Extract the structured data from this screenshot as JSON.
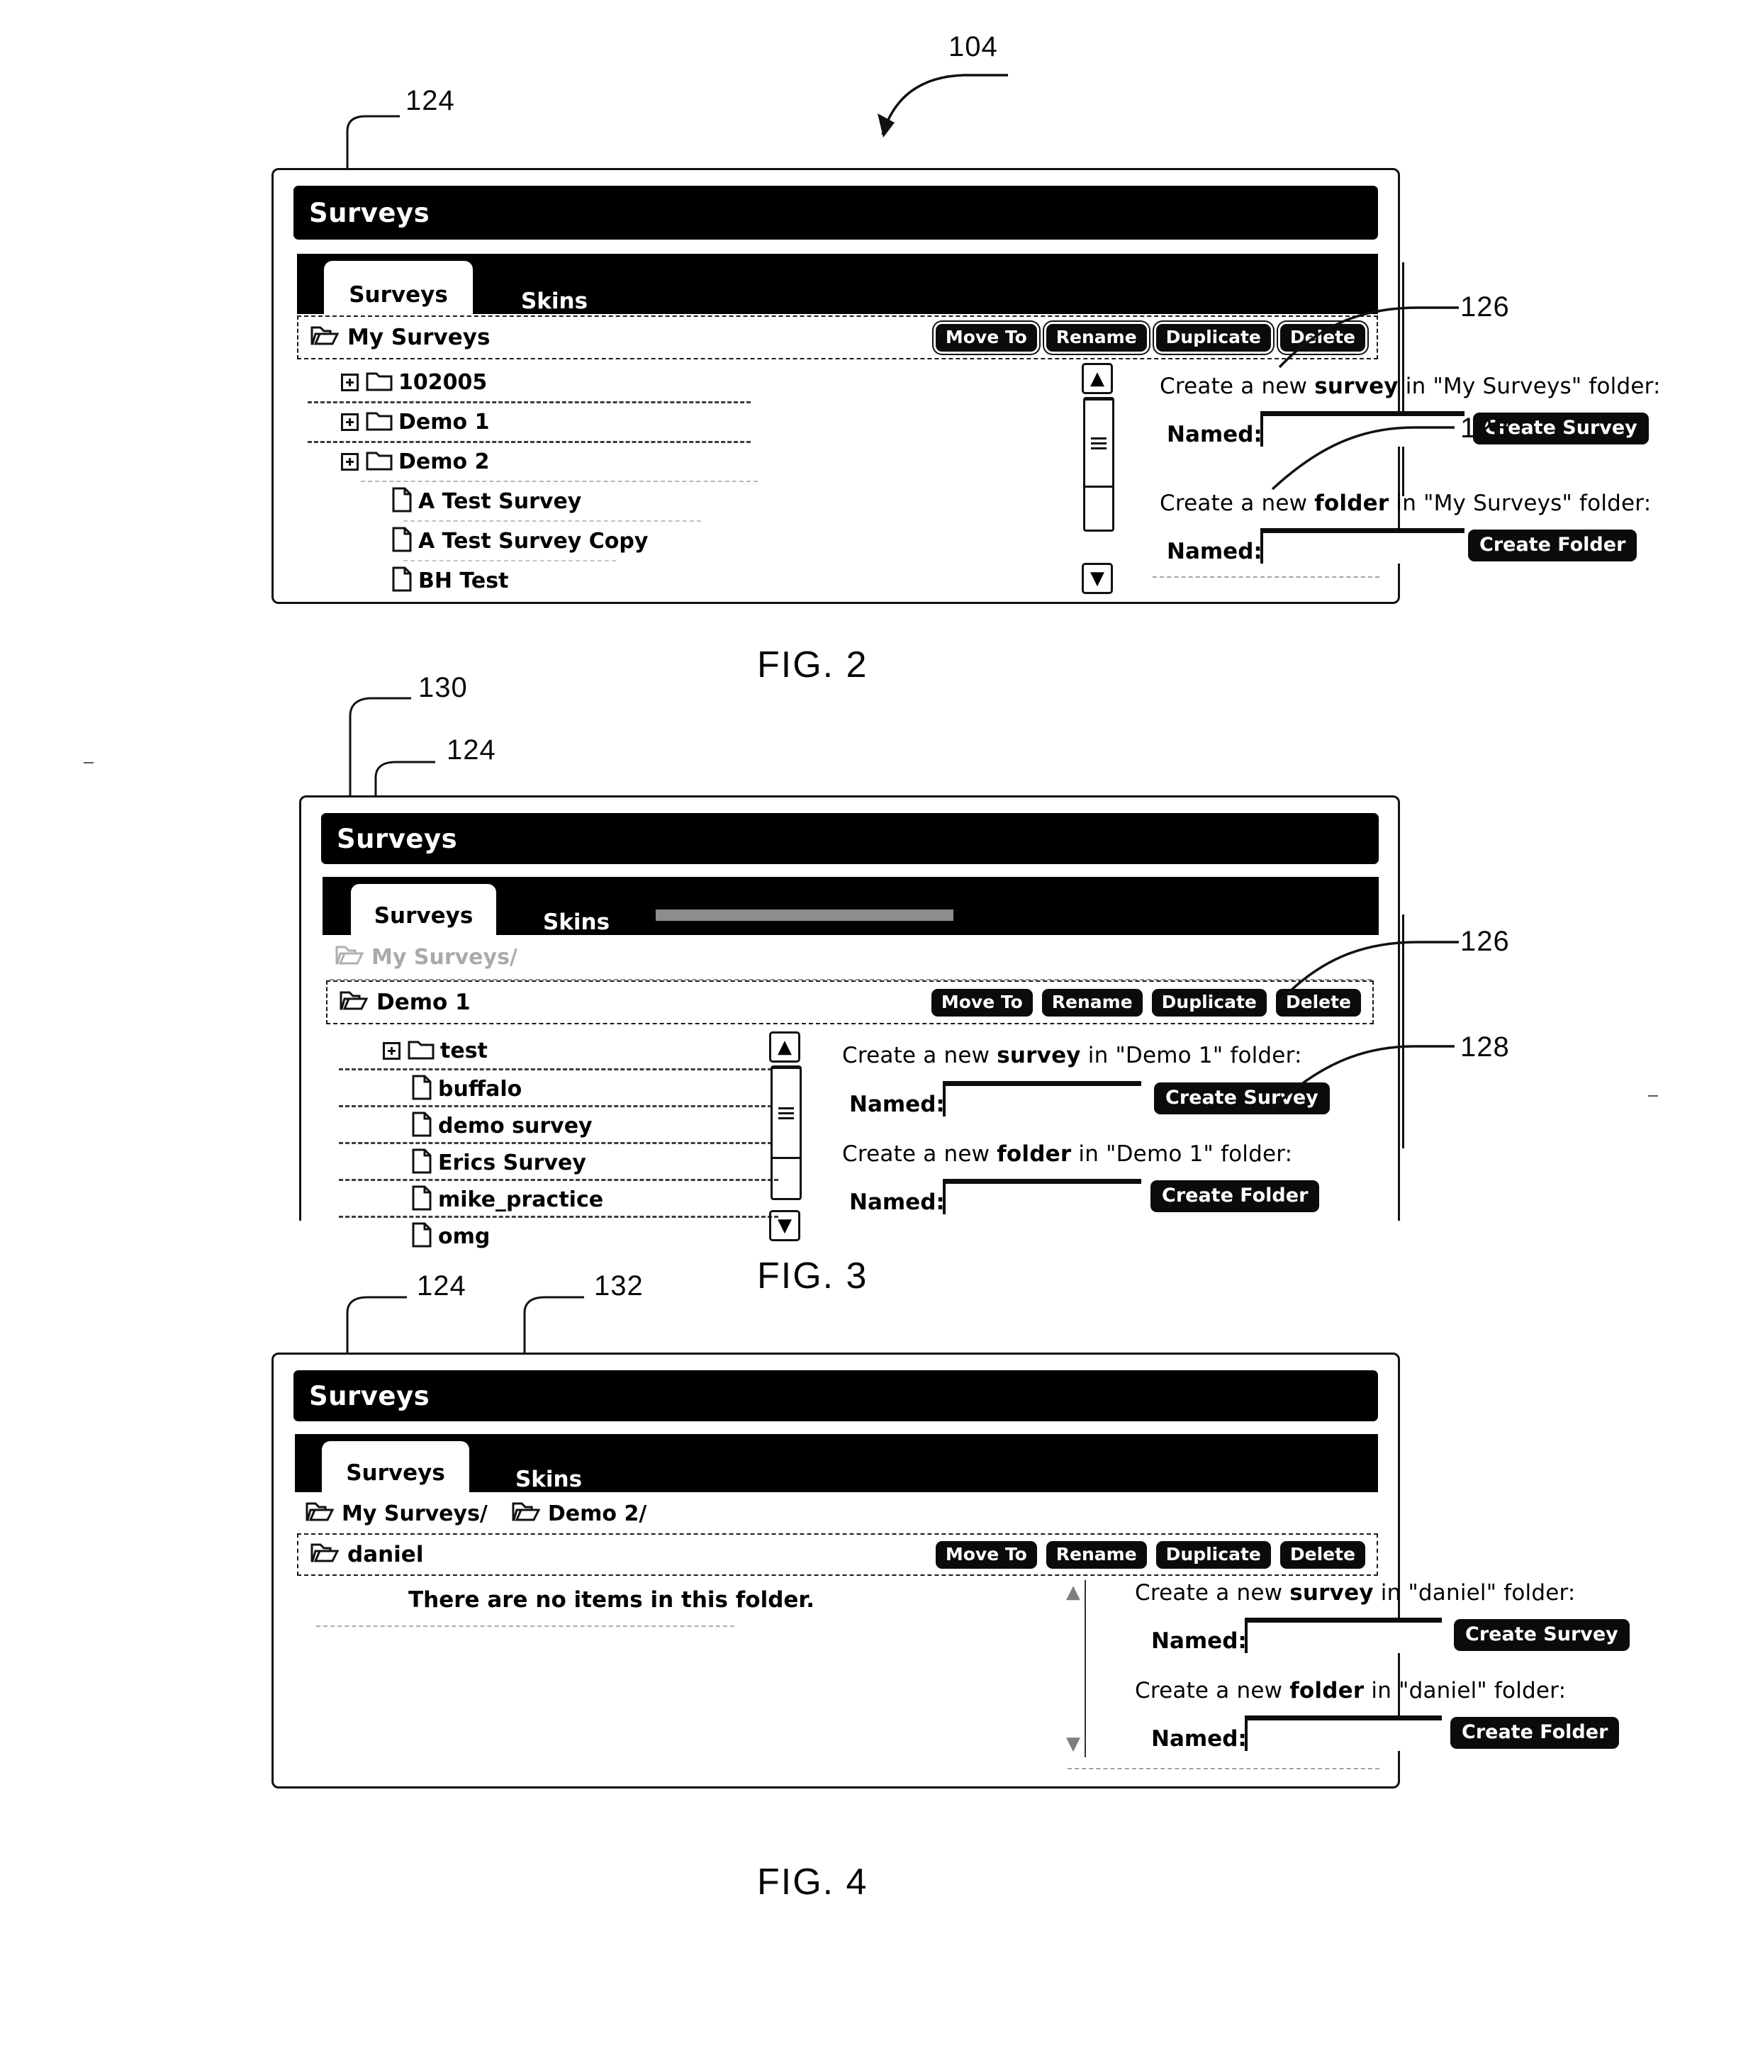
{
  "page": {
    "figure_callouts": {
      "c104": "104",
      "c124": "124",
      "c126": "126",
      "c128": "128",
      "c130": "130",
      "c132": "132"
    },
    "figure_labels": {
      "fig2": "FIG. 2",
      "fig3": "FIG. 3",
      "fig4": "FIG. 4"
    }
  },
  "common": {
    "window_title": "Surveys",
    "tabs": [
      {
        "label": "Surveys",
        "active": true
      },
      {
        "label": "Skins",
        "active": false
      }
    ],
    "action_buttons": [
      "Move To",
      "Rename",
      "Duplicate",
      "Delete"
    ],
    "named_label": "Named:",
    "create_survey_button": "Create Survey",
    "create_folder_button": "Create Folder",
    "named_value": "",
    "named_placeholder": "",
    "icons": {
      "folder": "folder-icon",
      "folder_open": "folder-open-icon",
      "document": "document-icon",
      "expand": "plus-expander-icon",
      "scroll_up": "scroll-up-arrow-icon",
      "scroll_down": "scroll-down-arrow-icon",
      "scroll_thumb": "scrollbar-thumb-grip-icon"
    }
  },
  "fig2": {
    "window_title": "Surveys",
    "breadcrumbs": [],
    "current_folder": "My Surveys",
    "tree_items": [
      {
        "label": "102005",
        "type": "folder",
        "expandable": true,
        "indent": 0
      },
      {
        "label": "Demo 1",
        "type": "folder",
        "expandable": true,
        "indent": 0
      },
      {
        "label": "Demo 2",
        "type": "folder",
        "expandable": true,
        "indent": 0
      },
      {
        "label": "A Test Survey",
        "type": "document",
        "expandable": false,
        "indent": 1
      },
      {
        "label": "A Test Survey Copy",
        "type": "document",
        "expandable": false,
        "indent": 1
      },
      {
        "label": "BH Test",
        "type": "document",
        "expandable": false,
        "indent": 1
      }
    ],
    "create_survey_text_pre": "Create a new ",
    "create_survey_text_bold": "survey",
    "create_survey_text_post": " in \"My Surveys\" folder:",
    "create_folder_text_pre": "Create a new ",
    "create_folder_text_bold": "folder",
    "create_folder_text_post": " in \"My Surveys\" folder:"
  },
  "fig3": {
    "window_title": "Surveys",
    "breadcrumbs": [
      {
        "label": "My Surveys/",
        "faded": true
      }
    ],
    "current_folder": "Demo 1",
    "tree_items": [
      {
        "label": "test",
        "type": "folder",
        "expandable": true,
        "indent": 0
      },
      {
        "label": "buffalo",
        "type": "document",
        "expandable": false,
        "indent": 1
      },
      {
        "label": "demo survey",
        "type": "document",
        "expandable": false,
        "indent": 1
      },
      {
        "label": "Erics Survey",
        "type": "document",
        "expandable": false,
        "indent": 1
      },
      {
        "label": "mike_practice",
        "type": "document",
        "expandable": false,
        "indent": 1
      },
      {
        "label": "omg",
        "type": "document",
        "expandable": false,
        "indent": 1
      }
    ],
    "create_survey_text_pre": "Create a new ",
    "create_survey_text_bold": "survey",
    "create_survey_text_post": " in \"Demo 1\" folder:",
    "create_folder_text_pre": "Create a new ",
    "create_folder_text_bold": "folder",
    "create_folder_text_post": " in \"Demo 1\" folder:"
  },
  "fig4": {
    "window_title": "Surveys",
    "breadcrumbs": [
      {
        "label": "My Surveys/",
        "faded": false
      },
      {
        "label": "Demo 2/",
        "faded": false
      }
    ],
    "current_folder": "daniel",
    "empty_message": "There are no items in this folder.",
    "tree_items": [],
    "create_survey_text_pre": "Create a new ",
    "create_survey_text_bold": "survey",
    "create_survey_text_post": " in \"daniel\" folder:",
    "create_folder_text_pre": "Create a new ",
    "create_folder_text_bold": "folder",
    "create_folder_text_post": " in \"daniel\" folder:"
  }
}
